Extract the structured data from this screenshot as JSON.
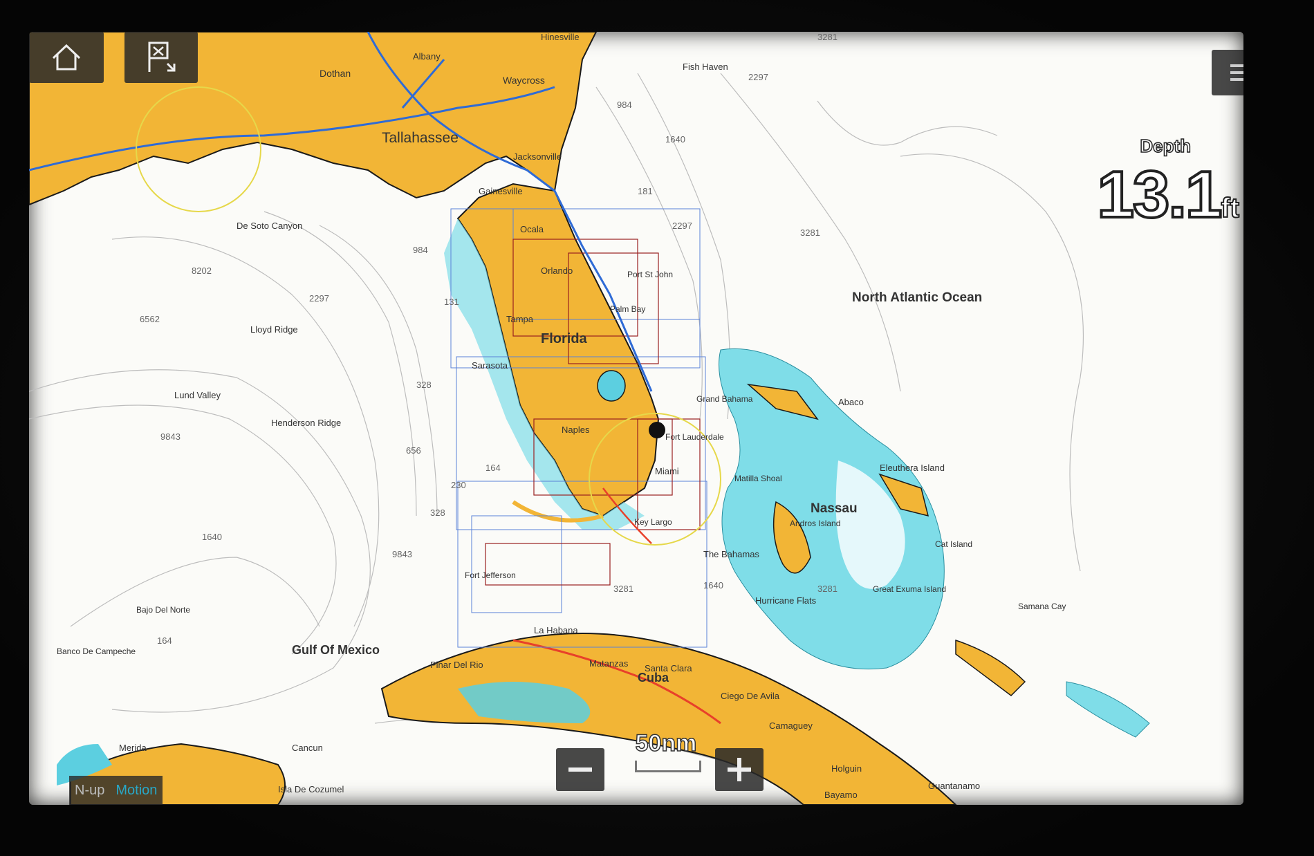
{
  "depth": {
    "label": "Depth",
    "value": "13.1",
    "unit": "ft"
  },
  "scale": {
    "label": "50nm"
  },
  "mode": {
    "primary": "N-up",
    "secondary": "Motion"
  },
  "labels": {
    "tallahassee": "Tallahassee",
    "dothan": "Dothan",
    "albany": "Albany",
    "waycross": "Waycross",
    "hinesville": "Hinesville",
    "jacksonville": "Jacksonville",
    "gainesville": "Gainesville",
    "ocala": "Ocala",
    "orlando": "Orlando",
    "florida": "Florida",
    "tampa": "Tampa",
    "sarasota": "Sarasota",
    "naples": "Naples",
    "miami": "Miami",
    "fortlauderdale": "Fort Lauderdale",
    "palmbay": "Palm Bay",
    "portstjohn": "Port St John",
    "keylargo": "Key Largo",
    "fortjefferson": "Fort Jefferson",
    "nassau": "Nassau",
    "bahamas": "The Bahamas",
    "northatlantic": "North Atlantic Ocean",
    "gulf": "Gulf Of Mexico",
    "cuba": "Cuba",
    "lahabana": "La Habana",
    "matanzas": "Matanzas",
    "santaclara": "Santa Clara",
    "pinardelrio": "Pinar Del Rio",
    "ciegodeavila": "Ciego De Avila",
    "camaguey": "Camaguey",
    "holguin": "Holguin",
    "bayamo": "Bayamo",
    "guantanamo": "Guantanamo",
    "merida": "Merida",
    "cancun": "Cancun",
    "cozumel": "Isla De Cozumel",
    "desoto": "De Soto Canyon",
    "lloyd": "Lloyd Ridge",
    "lund": "Lund Valley",
    "henderson": "Henderson Ridge",
    "eleuthera": "Eleuthera Island",
    "abaco": "Abaco",
    "hurricane": "Hurricane Flats",
    "greatexuma": "Great Exuma Island",
    "catisland": "Cat Island",
    "andros": "Andros Island",
    "grandbahama": "Grand Bahama",
    "mastershoal": "Matilla Shoal",
    "samana": "Samana Cay",
    "fishhaven": "Fish Haven",
    "bajo": "Bajo Del Norte",
    "banco": "Banco De Campeche"
  },
  "depth_soundings": [
    "3281",
    "2297",
    "984",
    "1640",
    "181",
    "2297",
    "3281",
    "8202",
    "6562",
    "2297",
    "984",
    "131",
    "328",
    "656",
    "9843",
    "164",
    "230",
    "328",
    "9843",
    "1640",
    "164",
    "3281",
    "1640",
    "3281"
  ]
}
